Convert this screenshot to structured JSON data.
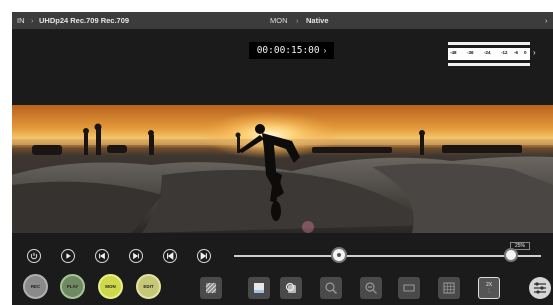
{
  "topbar": {
    "input_label": "IN",
    "separator": "›",
    "input_format": "UHDp24 Rec.709 Rec.709",
    "monitor_label": "MON",
    "monitor_value": "Native",
    "more_chevron": "›"
  },
  "timecode": {
    "value": "00:00:15:00",
    "chevron": "›"
  },
  "audio_meter": {
    "scale": [
      "-48",
      "-36",
      "-24",
      "-12",
      "-6",
      "0"
    ],
    "chevron": "›"
  },
  "playback": {
    "buttons": [
      "power-icon",
      "play-icon",
      "step-back-icon",
      "step-forward-icon",
      "skip-start-icon",
      "skip-end-icon"
    ],
    "scrub_position": 0.37,
    "volume_label": "25%",
    "volume_level": 0.25
  },
  "modes": {
    "rec": "REC",
    "play": "PLAY",
    "mon": "MON",
    "edit": "EDIT"
  },
  "tools": {
    "zoom_label": "2X"
  },
  "colors": {
    "background": "#1b1b1b",
    "topbar": "#3c3c3c",
    "play_mode": "#6f8a62",
    "mon_mode": "#cfd84a",
    "edit_mode": "#c7c778"
  }
}
